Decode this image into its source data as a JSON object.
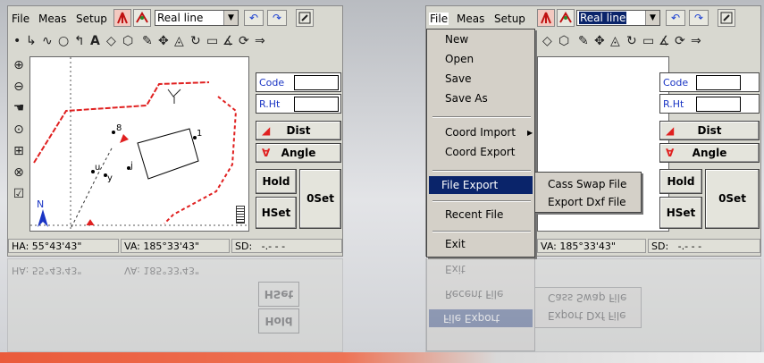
{
  "menubar": {
    "file": "File",
    "meas": "Meas",
    "setup": "Setup"
  },
  "combo": {
    "value": "Real line"
  },
  "fields": {
    "code_label": "Code",
    "rht_label": "R.Ht"
  },
  "buttons": {
    "dist": "Dist",
    "angle": "Angle",
    "hold": "Hold",
    "hset": "HSet",
    "oset": "0Set"
  },
  "status": {
    "ha": "HA:  55°43'43\"",
    "va": "VA: 185°33'43\"",
    "sd_label": "SD:",
    "sd_value": "-.- - -"
  },
  "canvas": {
    "north_label": "N",
    "point_labels": [
      "8",
      "1",
      "u",
      "y",
      "j"
    ]
  },
  "file_menu": {
    "items": [
      "New",
      "Open",
      "Save",
      "Save As",
      "Coord Import",
      "Coord Export",
      "File Export",
      "Recent File",
      "Exit"
    ],
    "highlighted": "File Export"
  },
  "submenu": {
    "items": [
      "Cass Swap File",
      "Export Dxf File"
    ]
  },
  "colors": {
    "highlight": "#0a246a",
    "stripe": "#ea5b3b",
    "red_line": "#e02020",
    "link_blue": "#1a35c4"
  },
  "icons": [
    "station-icon",
    "survey-icon",
    "undo-icon",
    "redo-icon",
    "zoom-in-icon",
    "zoom-out-icon",
    "pan-icon",
    "north-arrow-icon"
  ]
}
